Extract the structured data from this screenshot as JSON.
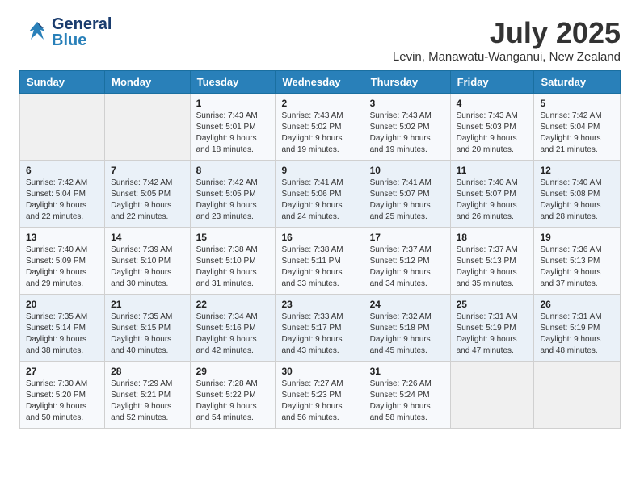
{
  "header": {
    "logo_general": "General",
    "logo_blue": "Blue",
    "month_title": "July 2025",
    "location": "Levin, Manawatu-Wanganui, New Zealand"
  },
  "calendar": {
    "days_of_week": [
      "Sunday",
      "Monday",
      "Tuesday",
      "Wednesday",
      "Thursday",
      "Friday",
      "Saturday"
    ],
    "weeks": [
      [
        {
          "day": "",
          "detail": ""
        },
        {
          "day": "",
          "detail": ""
        },
        {
          "day": "1",
          "detail": "Sunrise: 7:43 AM\nSunset: 5:01 PM\nDaylight: 9 hours\nand 18 minutes."
        },
        {
          "day": "2",
          "detail": "Sunrise: 7:43 AM\nSunset: 5:02 PM\nDaylight: 9 hours\nand 19 minutes."
        },
        {
          "day": "3",
          "detail": "Sunrise: 7:43 AM\nSunset: 5:02 PM\nDaylight: 9 hours\nand 19 minutes."
        },
        {
          "day": "4",
          "detail": "Sunrise: 7:43 AM\nSunset: 5:03 PM\nDaylight: 9 hours\nand 20 minutes."
        },
        {
          "day": "5",
          "detail": "Sunrise: 7:42 AM\nSunset: 5:04 PM\nDaylight: 9 hours\nand 21 minutes."
        }
      ],
      [
        {
          "day": "6",
          "detail": "Sunrise: 7:42 AM\nSunset: 5:04 PM\nDaylight: 9 hours\nand 22 minutes."
        },
        {
          "day": "7",
          "detail": "Sunrise: 7:42 AM\nSunset: 5:05 PM\nDaylight: 9 hours\nand 22 minutes."
        },
        {
          "day": "8",
          "detail": "Sunrise: 7:42 AM\nSunset: 5:05 PM\nDaylight: 9 hours\nand 23 minutes."
        },
        {
          "day": "9",
          "detail": "Sunrise: 7:41 AM\nSunset: 5:06 PM\nDaylight: 9 hours\nand 24 minutes."
        },
        {
          "day": "10",
          "detail": "Sunrise: 7:41 AM\nSunset: 5:07 PM\nDaylight: 9 hours\nand 25 minutes."
        },
        {
          "day": "11",
          "detail": "Sunrise: 7:40 AM\nSunset: 5:07 PM\nDaylight: 9 hours\nand 26 minutes."
        },
        {
          "day": "12",
          "detail": "Sunrise: 7:40 AM\nSunset: 5:08 PM\nDaylight: 9 hours\nand 28 minutes."
        }
      ],
      [
        {
          "day": "13",
          "detail": "Sunrise: 7:40 AM\nSunset: 5:09 PM\nDaylight: 9 hours\nand 29 minutes."
        },
        {
          "day": "14",
          "detail": "Sunrise: 7:39 AM\nSunset: 5:10 PM\nDaylight: 9 hours\nand 30 minutes."
        },
        {
          "day": "15",
          "detail": "Sunrise: 7:38 AM\nSunset: 5:10 PM\nDaylight: 9 hours\nand 31 minutes."
        },
        {
          "day": "16",
          "detail": "Sunrise: 7:38 AM\nSunset: 5:11 PM\nDaylight: 9 hours\nand 33 minutes."
        },
        {
          "day": "17",
          "detail": "Sunrise: 7:37 AM\nSunset: 5:12 PM\nDaylight: 9 hours\nand 34 minutes."
        },
        {
          "day": "18",
          "detail": "Sunrise: 7:37 AM\nSunset: 5:13 PM\nDaylight: 9 hours\nand 35 minutes."
        },
        {
          "day": "19",
          "detail": "Sunrise: 7:36 AM\nSunset: 5:13 PM\nDaylight: 9 hours\nand 37 minutes."
        }
      ],
      [
        {
          "day": "20",
          "detail": "Sunrise: 7:35 AM\nSunset: 5:14 PM\nDaylight: 9 hours\nand 38 minutes."
        },
        {
          "day": "21",
          "detail": "Sunrise: 7:35 AM\nSunset: 5:15 PM\nDaylight: 9 hours\nand 40 minutes."
        },
        {
          "day": "22",
          "detail": "Sunrise: 7:34 AM\nSunset: 5:16 PM\nDaylight: 9 hours\nand 42 minutes."
        },
        {
          "day": "23",
          "detail": "Sunrise: 7:33 AM\nSunset: 5:17 PM\nDaylight: 9 hours\nand 43 minutes."
        },
        {
          "day": "24",
          "detail": "Sunrise: 7:32 AM\nSunset: 5:18 PM\nDaylight: 9 hours\nand 45 minutes."
        },
        {
          "day": "25",
          "detail": "Sunrise: 7:31 AM\nSunset: 5:19 PM\nDaylight: 9 hours\nand 47 minutes."
        },
        {
          "day": "26",
          "detail": "Sunrise: 7:31 AM\nSunset: 5:19 PM\nDaylight: 9 hours\nand 48 minutes."
        }
      ],
      [
        {
          "day": "27",
          "detail": "Sunrise: 7:30 AM\nSunset: 5:20 PM\nDaylight: 9 hours\nand 50 minutes."
        },
        {
          "day": "28",
          "detail": "Sunrise: 7:29 AM\nSunset: 5:21 PM\nDaylight: 9 hours\nand 52 minutes."
        },
        {
          "day": "29",
          "detail": "Sunrise: 7:28 AM\nSunset: 5:22 PM\nDaylight: 9 hours\nand 54 minutes."
        },
        {
          "day": "30",
          "detail": "Sunrise: 7:27 AM\nSunset: 5:23 PM\nDaylight: 9 hours\nand 56 minutes."
        },
        {
          "day": "31",
          "detail": "Sunrise: 7:26 AM\nSunset: 5:24 PM\nDaylight: 9 hours\nand 58 minutes."
        },
        {
          "day": "",
          "detail": ""
        },
        {
          "day": "",
          "detail": ""
        }
      ]
    ]
  }
}
